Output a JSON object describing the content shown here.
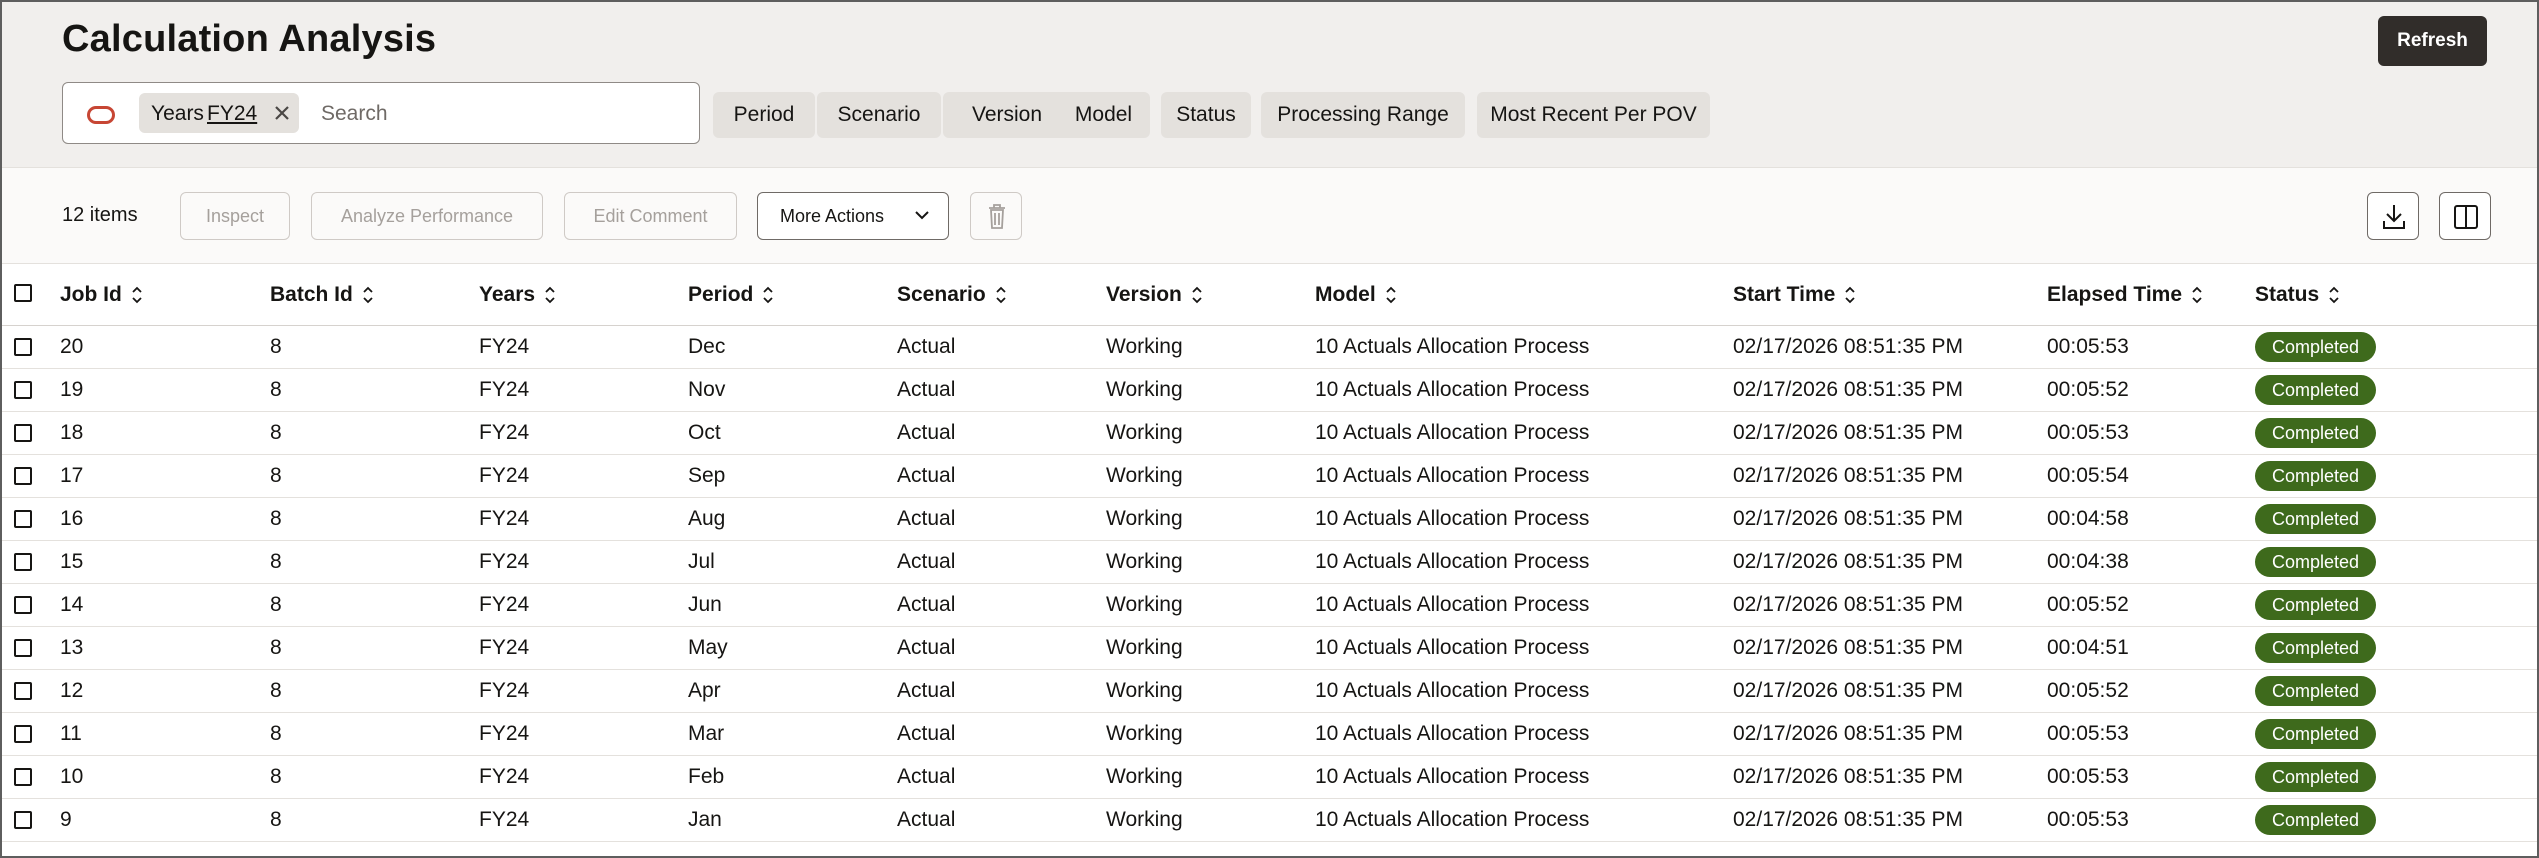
{
  "header": {
    "title": "Calculation Analysis",
    "refresh_label": "Refresh"
  },
  "search": {
    "chip_key": "Years",
    "chip_value": "FY24",
    "placeholder": "Search",
    "value": ""
  },
  "filters": [
    "Period",
    "Scenario",
    "Version",
    "Model",
    "Status",
    "Processing Range",
    "Most Recent Per POV"
  ],
  "toolbar": {
    "items_count": "12 items",
    "inspect_label": "Inspect",
    "analyze_label": "Analyze Performance",
    "edit_comment_label": "Edit Comment",
    "more_actions_label": "More Actions"
  },
  "table": {
    "columns": [
      "Job Id",
      "Batch Id",
      "Years",
      "Period",
      "Scenario",
      "Version",
      "Model",
      "Start Time",
      "Elapsed Time",
      "Status"
    ],
    "rows": [
      [
        "20",
        "8",
        "FY24",
        "Dec",
        "Actual",
        "Working",
        "10 Actuals Allocation Process",
        "02/17/2026 08:51:35 PM",
        "00:05:53",
        "Completed"
      ],
      [
        "19",
        "8",
        "FY24",
        "Nov",
        "Actual",
        "Working",
        "10 Actuals Allocation Process",
        "02/17/2026 08:51:35 PM",
        "00:05:52",
        "Completed"
      ],
      [
        "18",
        "8",
        "FY24",
        "Oct",
        "Actual",
        "Working",
        "10 Actuals Allocation Process",
        "02/17/2026 08:51:35 PM",
        "00:05:53",
        "Completed"
      ],
      [
        "17",
        "8",
        "FY24",
        "Sep",
        "Actual",
        "Working",
        "10 Actuals Allocation Process",
        "02/17/2026 08:51:35 PM",
        "00:05:54",
        "Completed"
      ],
      [
        "16",
        "8",
        "FY24",
        "Aug",
        "Actual",
        "Working",
        "10 Actuals Allocation Process",
        "02/17/2026 08:51:35 PM",
        "00:04:58",
        "Completed"
      ],
      [
        "15",
        "8",
        "FY24",
        "Jul",
        "Actual",
        "Working",
        "10 Actuals Allocation Process",
        "02/17/2026 08:51:35 PM",
        "00:04:38",
        "Completed"
      ],
      [
        "14",
        "8",
        "FY24",
        "Jun",
        "Actual",
        "Working",
        "10 Actuals Allocation Process",
        "02/17/2026 08:51:35 PM",
        "00:05:52",
        "Completed"
      ],
      [
        "13",
        "8",
        "FY24",
        "May",
        "Actual",
        "Working",
        "10 Actuals Allocation Process",
        "02/17/2026 08:51:35 PM",
        "00:04:51",
        "Completed"
      ],
      [
        "12",
        "8",
        "FY24",
        "Apr",
        "Actual",
        "Working",
        "10 Actuals Allocation Process",
        "02/17/2026 08:51:35 PM",
        "00:05:52",
        "Completed"
      ],
      [
        "11",
        "8",
        "FY24",
        "Mar",
        "Actual",
        "Working",
        "10 Actuals Allocation Process",
        "02/17/2026 08:51:35 PM",
        "00:05:53",
        "Completed"
      ],
      [
        "10",
        "8",
        "FY24",
        "Feb",
        "Actual",
        "Working",
        "10 Actuals Allocation Process",
        "02/17/2026 08:51:35 PM",
        "00:05:53",
        "Completed"
      ],
      [
        "9",
        "8",
        "FY24",
        "Jan",
        "Actual",
        "Working",
        "10 Actuals Allocation Process",
        "02/17/2026 08:51:35 PM",
        "00:05:53",
        "Completed"
      ]
    ]
  },
  "icons": {
    "brand": "oracle-icon",
    "chip_remove": "close-icon",
    "more_actions": "chevron-down-icon",
    "delete": "trash-icon",
    "export": "download-icon",
    "columns": "column-layout-icon",
    "sort": "sort-icon"
  },
  "colors": {
    "brand_red": "#c74634",
    "primary_button": "#312d2a",
    "status_completed": "#3e6a1c",
    "header_bg": "#f1efed"
  }
}
